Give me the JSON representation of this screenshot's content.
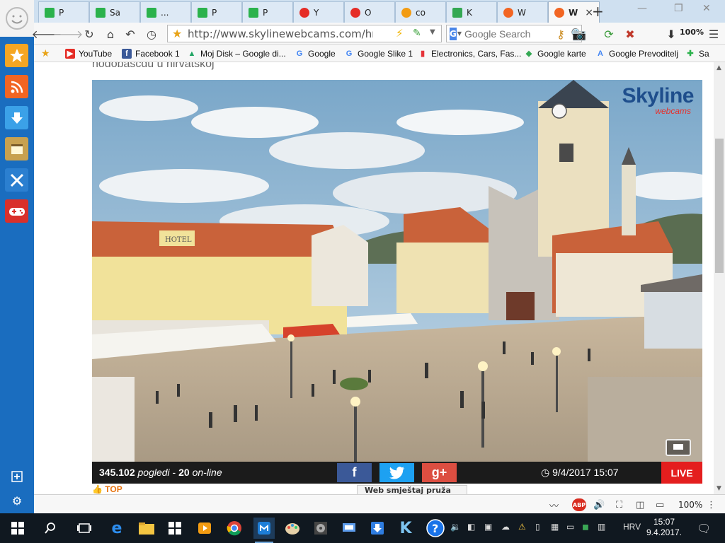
{
  "browser": {
    "tabs": [
      {
        "label": "P",
        "icon": "puzzle-green"
      },
      {
        "label": "Sa",
        "icon": "puzzle-green"
      },
      {
        "label": "...",
        "icon": "puzzle-green"
      },
      {
        "label": "P",
        "icon": "puzzle-green"
      },
      {
        "label": "P",
        "icon": "puzzle-green"
      },
      {
        "label": "Y",
        "icon": "youtube-red"
      },
      {
        "label": "O",
        "icon": "youtube-red"
      },
      {
        "label": "co",
        "icon": "chat-orange"
      },
      {
        "label": "K",
        "icon": "maps"
      },
      {
        "label": "W",
        "icon": "skyline-orange"
      },
      {
        "label": "W",
        "icon": "skyline-orange",
        "active": true
      }
    ],
    "new_tab": "+",
    "url": "http://www.skylinewebcams.com/hr/webca",
    "search_placeholder": "Google Search",
    "zoom_toolbar": "100%"
  },
  "bookmarks": [
    {
      "label": "YouTube",
      "icon": "youtube-icon",
      "color": "#e52d27"
    },
    {
      "label": "Facebook 1",
      "icon": "facebook-icon",
      "color": "#3b5998"
    },
    {
      "label": "Moj Disk – Google di...",
      "icon": "drive-icon",
      "color": "#1fa463"
    },
    {
      "label": "Google",
      "icon": "google-icon",
      "color": "#4285f4"
    },
    {
      "label": "Google Slike 1",
      "icon": "google-icon",
      "color": "#4285f4"
    },
    {
      "label": "Electronics, Cars, Fas...",
      "icon": "ebay-icon",
      "color": "#e53238"
    },
    {
      "label": "Google karte",
      "icon": "maps-icon",
      "color": "#34a853"
    },
    {
      "label": "Google Prevoditelj",
      "icon": "translate-icon",
      "color": "#4285f4"
    },
    {
      "label": "Sa",
      "icon": "puzzle-icon",
      "color": "#2bb24c"
    }
  ],
  "page": {
    "heading_fragment": "nodobascdu u hirvatskoj",
    "logo_main": "Skyline",
    "logo_sub": "webcams",
    "stats": {
      "views": "345.102",
      "views_label": "pogledi",
      "online": "20",
      "online_label": "on-line"
    },
    "social": [
      "f",
      "twitter",
      "g+"
    ],
    "datetime": "9/4/2017 15:07",
    "live_label": "LIVE",
    "top_link": "TOP",
    "tooltip_peek": "Web smještaj pruža"
  },
  "addon_bar": {
    "zoom": "100%"
  },
  "taskbar": {
    "language": "HRV",
    "time": "15:07",
    "date": "9.4.2017."
  },
  "colors": {
    "sidebar": "#1a6dbf",
    "live": "#e41e1e",
    "facebook": "#3b5998",
    "twitter": "#1da1f2",
    "gplus": "#dc4e41",
    "top_link": "#e8730e"
  }
}
